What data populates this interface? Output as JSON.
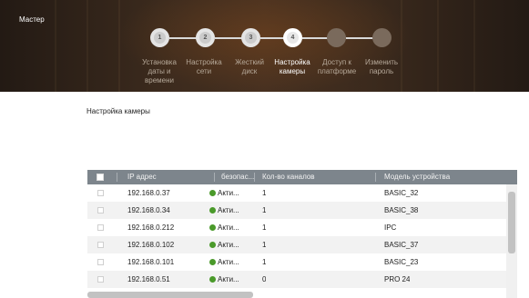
{
  "wizard": {
    "title": "Мастер",
    "steps": [
      {
        "number": "1",
        "label_lines": [
          "Установка",
          "даты и",
          "времени"
        ],
        "state": "done"
      },
      {
        "number": "2",
        "label_lines": [
          "Настройка",
          "сети"
        ],
        "state": "done"
      },
      {
        "number": "3",
        "label_lines": [
          "Жесткий",
          "диск"
        ],
        "state": "done"
      },
      {
        "number": "4",
        "label_lines": [
          "Настройка",
          "камеры"
        ],
        "state": "active"
      },
      {
        "number": "",
        "label_lines": [
          "Доступ к",
          "платформе"
        ],
        "state": "todo"
      },
      {
        "number": "",
        "label_lines": [
          "Изменить",
          "пароль"
        ],
        "state": "todo"
      }
    ]
  },
  "section": {
    "title": "Настройка камеры"
  },
  "table": {
    "columns": [
      "IP адрес",
      "безопас...",
      "Кол-во каналов",
      "Модель устройства"
    ],
    "rows": [
      {
        "ip": "192.168.0.37",
        "security": "Акти...",
        "channels": "1",
        "model": "BASIC_32"
      },
      {
        "ip": "192.168.0.34",
        "security": "Акти...",
        "channels": "1",
        "model": "BASIC_38"
      },
      {
        "ip": "192.168.0.212",
        "security": "Акти...",
        "channels": "1",
        "model": "IPC"
      },
      {
        "ip": "192.168.0.102",
        "security": "Акти...",
        "channels": "1",
        "model": "BASIC_37"
      },
      {
        "ip": "192.168.0.101",
        "security": "Акти...",
        "channels": "1",
        "model": "BASIC_23"
      },
      {
        "ip": "192.168.0.51",
        "security": "Акти...",
        "channels": "0",
        "model": "PRO 24"
      }
    ]
  },
  "colors": {
    "header_bg": "#3b2a1d",
    "table_header": "#7d858c",
    "status_active": "#4a9a2a"
  }
}
